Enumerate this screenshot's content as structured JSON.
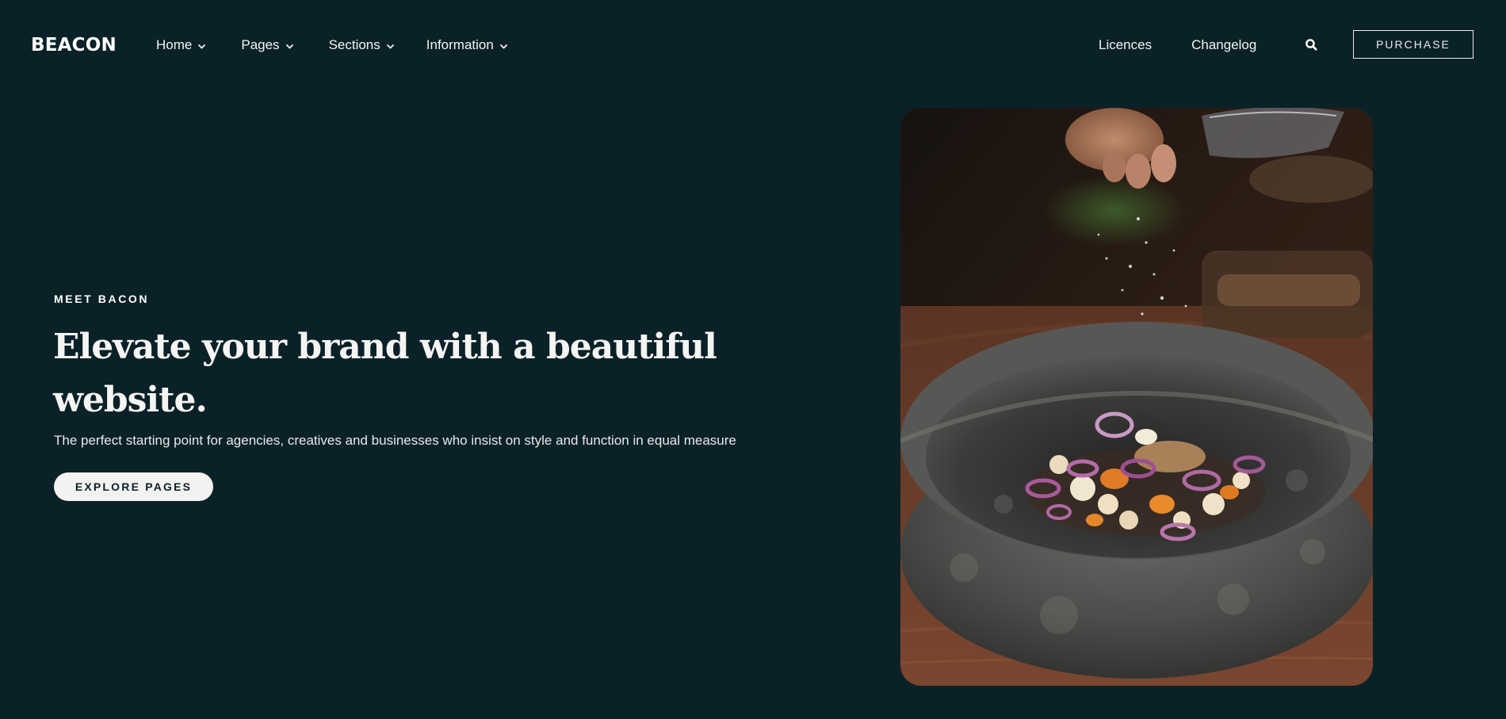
{
  "brand": {
    "logo_text": "BEACON"
  },
  "nav": {
    "primary": [
      {
        "label": "Home",
        "icon": "chevron-down-icon"
      },
      {
        "label": "Pages",
        "icon": "chevron-down-icon"
      },
      {
        "label": "Sections",
        "icon": "chevron-down-icon"
      },
      {
        "label": "Information",
        "icon": "chevron-down-icon"
      }
    ],
    "secondary": [
      {
        "label": "Licences"
      },
      {
        "label": "Changelog"
      }
    ],
    "search_icon": "search-icon",
    "purchase_label": "PURCHASE"
  },
  "hero": {
    "eyebrow": "MEET BACON",
    "title": "Elevate your brand with a beautiful website.",
    "subtitle": "The perfect starting point for agencies, creatives and businesses who insist on style and function in equal measure",
    "cta_label": "EXPLORE PAGES"
  },
  "colors": {
    "background": "#0b2128",
    "text": "#ffffff",
    "button_bg": "#f2f2f0",
    "button_text": "#0b2128"
  }
}
